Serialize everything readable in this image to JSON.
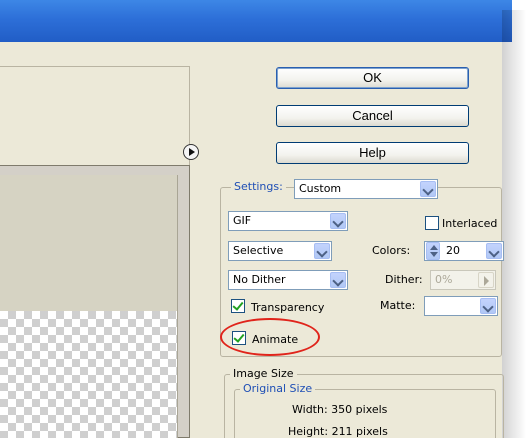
{
  "buttons": {
    "ok": "OK",
    "cancel": "Cancel",
    "help": "Help"
  },
  "settings": {
    "legend": "Settings:",
    "preset": "Custom",
    "format": "GIF",
    "interlaced_label": "Interlaced",
    "interlaced_checked": false,
    "reduction": "Selective",
    "colors_label": "Colors:",
    "colors_value": "20",
    "dither_algorithm": "No Dither",
    "dither_label": "Dither:",
    "dither_value": "0%",
    "transparency_label": "Transparency",
    "transparency_checked": true,
    "matte_label": "Matte:",
    "matte_value": "",
    "animate_label": "Animate",
    "animate_checked": true
  },
  "image_size": {
    "legend": "Image Size",
    "original_legend": "Original Size",
    "width_text": "Width: 350 pixels",
    "height_text": "Height: 211 pixels"
  },
  "icons": {
    "preview_menu": "menu-arrow-icon",
    "dropdown": "chevron-down-icon",
    "spinner": "up-down-arrows-icon",
    "slider": "play-arrow-icon"
  },
  "colors": {
    "dialog_bg": "#ece9d8",
    "titlebar": "#2d6fd8",
    "legend_blue": "#1f4fb5",
    "highlight_red": "#e0241b",
    "checkmark_green": "#21a121"
  }
}
